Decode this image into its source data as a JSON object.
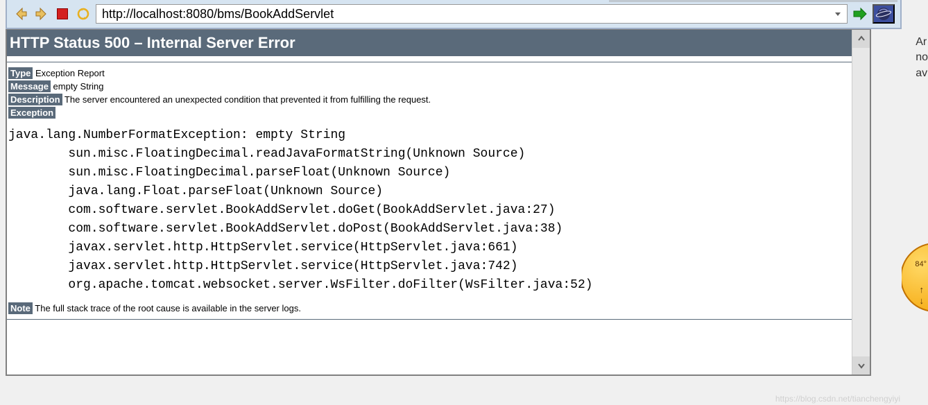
{
  "toolbar": {
    "url": "http://localhost:8080/bms/BookAddServlet"
  },
  "error": {
    "status_title": "HTTP Status 500 – Internal Server Error",
    "type_label": "Type",
    "type_value": " Exception Report",
    "message_label": "Message",
    "message_value": " empty String",
    "description_label": "Description",
    "description_value": " The server encountered an unexpected condition that prevented it from fulfilling the request.",
    "exception_label": "Exception",
    "stacktrace": "java.lang.NumberFormatException: empty String\n\tsun.misc.FloatingDecimal.readJavaFormatString(Unknown Source)\n\tsun.misc.FloatingDecimal.parseFloat(Unknown Source)\n\tjava.lang.Float.parseFloat(Unknown Source)\n\tcom.software.servlet.BookAddServlet.doGet(BookAddServlet.java:27)\n\tcom.software.servlet.BookAddServlet.doPost(BookAddServlet.java:38)\n\tjavax.servlet.http.HttpServlet.service(HttpServlet.java:661)\n\tjavax.servlet.http.HttpServlet.service(HttpServlet.java:742)\n\torg.apache.tomcat.websocket.server.WsFilter.doFilter(WsFilter.java:52)",
    "note_label": "Note",
    "note_value": " The full stack trace of the root cause is available in the server logs."
  },
  "side": {
    "line1": "Ar",
    "line2": "no",
    "line3": "av",
    "badge": "84°"
  },
  "watermark": "https://blog.csdn.net/tianchengyiyi"
}
